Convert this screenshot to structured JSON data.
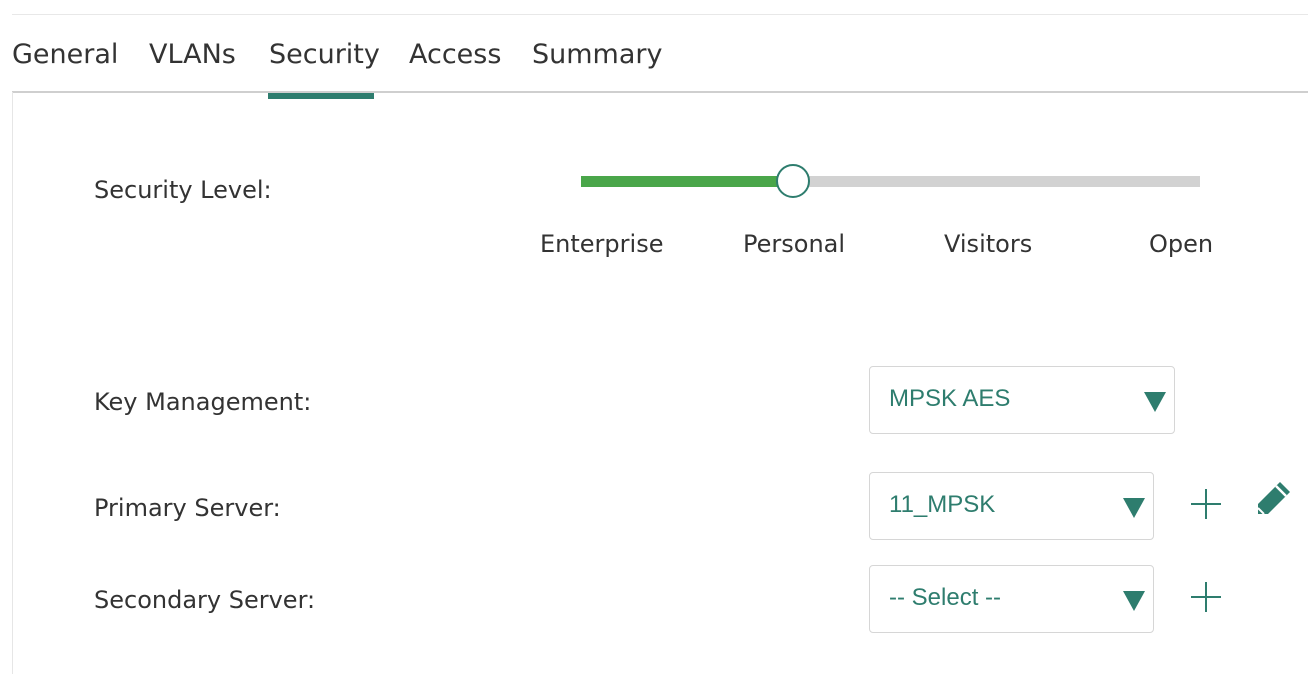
{
  "tabs": [
    {
      "label": "General",
      "active": false
    },
    {
      "label": "VLANs",
      "active": false
    },
    {
      "label": "Security",
      "active": true
    },
    {
      "label": "Access",
      "active": false
    },
    {
      "label": "Summary",
      "active": false
    }
  ],
  "security_level": {
    "label": "Security Level:",
    "levels": [
      "Enterprise",
      "Personal",
      "Visitors",
      "Open"
    ],
    "selected": "Personal",
    "fill_fraction": 0.343
  },
  "key_management": {
    "label": "Key Management:",
    "value": "MPSK AES"
  },
  "primary_server": {
    "label": "Primary Server:",
    "value": "11_MPSK",
    "add_icon": "plus-icon",
    "edit_icon": "pencil-icon"
  },
  "secondary_server": {
    "label": "Secondary Server:",
    "value": "-- Select --",
    "add_icon": "plus-icon"
  },
  "colors": {
    "accent": "#2e7d6e",
    "slider_fill": "#4aa64a",
    "slider_track": "#d2d2d2"
  }
}
